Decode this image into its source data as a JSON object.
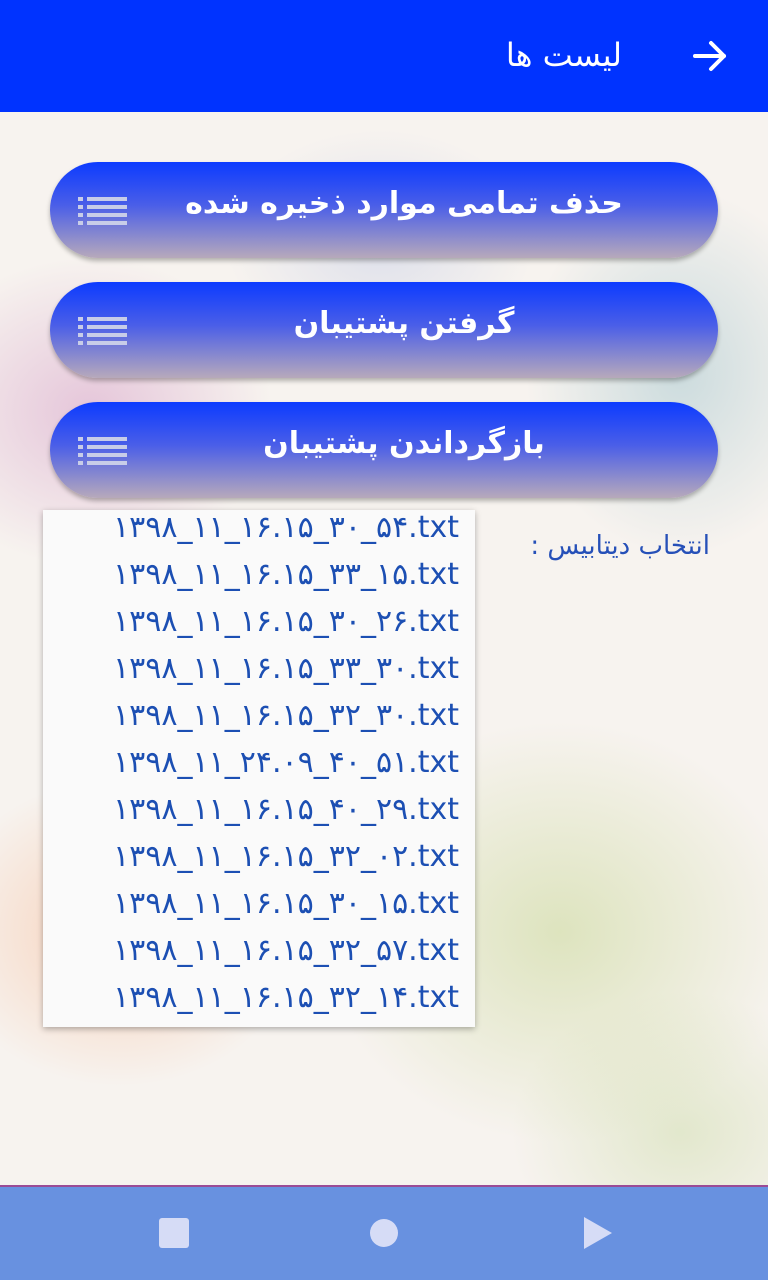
{
  "appbar": {
    "title": "لیست ها",
    "back_icon": "arrow-right-icon"
  },
  "buttons": [
    {
      "label": "حذف تمامی موارد ذخیره شده",
      "icon": "menu-lines-icon"
    },
    {
      "label": "گرفتن پشتیبان",
      "icon": "menu-lines-icon"
    },
    {
      "label": "بازگرداندن پشتیبان",
      "icon": "menu-lines-icon"
    }
  ],
  "database": {
    "label": "انتخاب دیتابیس :",
    "options": [
      "۱۳۹۸_۱۱_۱۶.۱۵_۳۰_۵۴.txt",
      "۱۳۹۸_۱۱_۱۶.۱۵_۳۳_۱۵.txt",
      "۱۳۹۸_۱۱_۱۶.۱۵_۳۰_۲۶.txt",
      "۱۳۹۸_۱۱_۱۶.۱۵_۳۳_۳۰.txt",
      "۱۳۹۸_۱۱_۱۶.۱۵_۳۲_۳۰.txt",
      "۱۳۹۸_۱۱_۲۴.۰۹_۴۰_۵۱.txt",
      "۱۳۹۸_۱۱_۱۶.۱۵_۴۰_۲۹.txt",
      "۱۳۹۸_۱۱_۱۶.۱۵_۳۲_۰۲.txt",
      "۱۳۹۸_۱۱_۱۶.۱۵_۳۰_۱۵.txt",
      "۱۳۹۸_۱۱_۱۶.۱۵_۳۲_۵۷.txt",
      "۱۳۹۸_۱۱_۱۶.۱۵_۳۲_۱۴.txt"
    ]
  },
  "colors": {
    "appbar": "#0033ff",
    "navbar": "#6891e0",
    "dropdown_text": "#1c4fb3"
  },
  "navbar": {
    "icons": [
      "recents-square-icon",
      "home-circle-icon",
      "back-triangle-icon"
    ]
  }
}
